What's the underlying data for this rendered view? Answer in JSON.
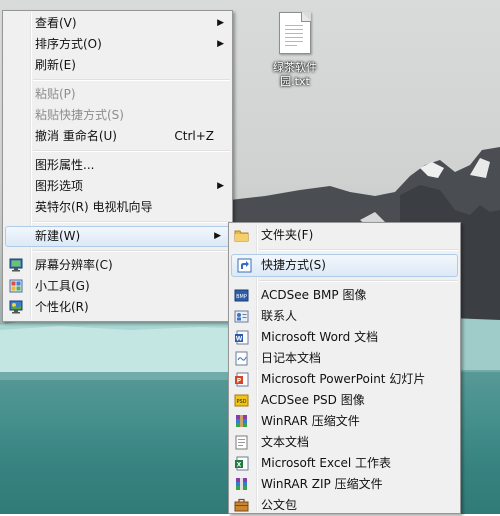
{
  "desktop": {
    "file": {
      "name": "绿茶软件园.txt",
      "icon": "text-file-icon"
    }
  },
  "context_menu": {
    "items": [
      {
        "label": "查看(V)",
        "submenu": true
      },
      {
        "label": "排序方式(O)",
        "submenu": true
      },
      {
        "label": "刷新(E)"
      },
      {
        "label": "粘贴(P)",
        "disabled": true
      },
      {
        "label": "粘贴快捷方式(S)",
        "disabled": true
      },
      {
        "label": "撤消 重命名(U)",
        "shortcut": "Ctrl+Z"
      },
      {
        "label": "图形属性..."
      },
      {
        "label": "图形选项",
        "submenu": true
      },
      {
        "label": "英特尔(R) 电视机向导"
      },
      {
        "label": "新建(W)",
        "submenu": true,
        "highlighted": true
      },
      {
        "label": "屏幕分辨率(C)",
        "icon": "display-icon"
      },
      {
        "label": "小工具(G)",
        "icon": "gadgets-icon"
      },
      {
        "label": "个性化(R)",
        "icon": "personalize-icon"
      }
    ]
  },
  "new_submenu": {
    "items": [
      {
        "label": "文件夹(F)",
        "icon": "folder-icon"
      },
      {
        "label": "快捷方式(S)",
        "icon": "shortcut-icon",
        "highlighted": true
      },
      {
        "label": "ACDSee BMP 图像",
        "icon": "bmp-icon"
      },
      {
        "label": "联系人",
        "icon": "contact-icon"
      },
      {
        "label": "Microsoft Word 文档",
        "icon": "word-icon"
      },
      {
        "label": "日记本文档",
        "icon": "journal-icon"
      },
      {
        "label": "Microsoft PowerPoint 幻灯片",
        "icon": "powerpoint-icon"
      },
      {
        "label": "ACDSee PSD 图像",
        "icon": "psd-icon"
      },
      {
        "label": "WinRAR 压缩文件",
        "icon": "rar-icon"
      },
      {
        "label": "文本文档",
        "icon": "text-document-icon"
      },
      {
        "label": "Microsoft Excel 工作表",
        "icon": "excel-icon"
      },
      {
        "label": "WinRAR ZIP 压缩文件",
        "icon": "zip-icon"
      },
      {
        "label": "公文包",
        "icon": "briefcase-icon"
      }
    ]
  }
}
